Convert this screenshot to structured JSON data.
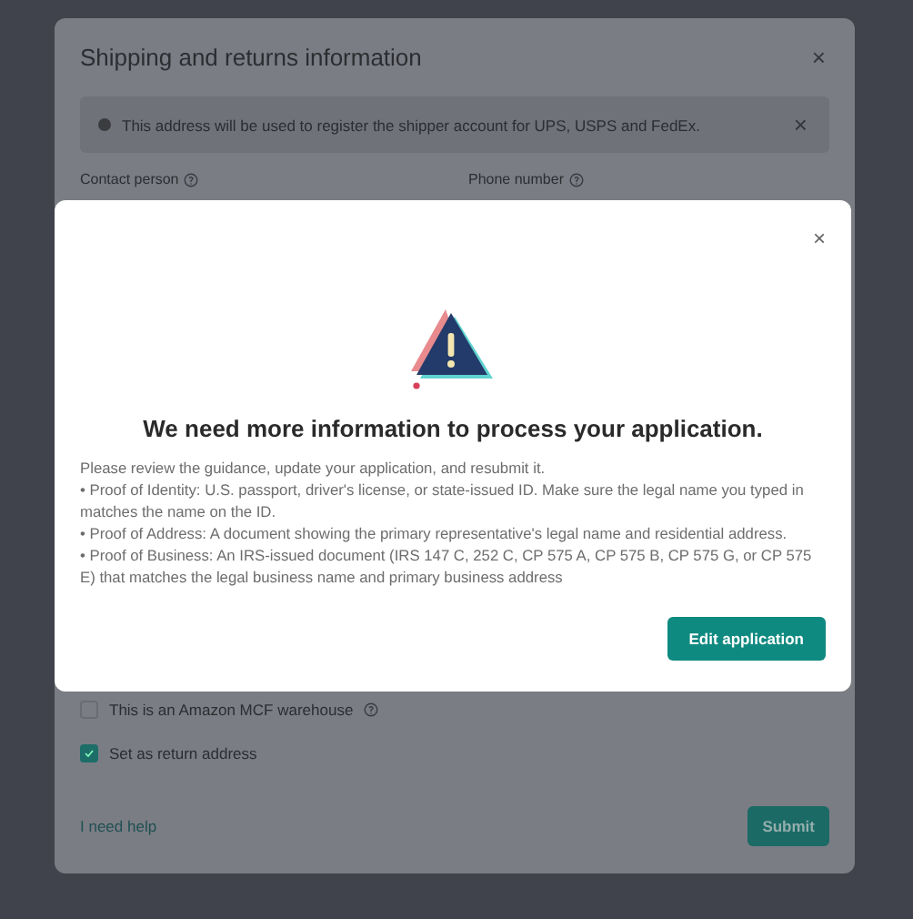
{
  "background_modal": {
    "title": "Shipping and returns information",
    "close": "×",
    "banner": {
      "text": "This address will be used to register the shipper account for UPS, USPS and FedEx.",
      "close": "×"
    },
    "fields": [
      {
        "label": "Contact person"
      },
      {
        "label": "Phone number"
      }
    ],
    "checkboxes": [
      {
        "label": "This is an Amazon MCF warehouse",
        "help": true,
        "checked": false
      },
      {
        "label": "Set as return address",
        "help": false,
        "checked": true
      }
    ],
    "help_link": "I need help",
    "submit": "Submit"
  },
  "dialog": {
    "close": "×",
    "title": "We need more information to process your application.",
    "lines": [
      "Please review the guidance, update your application, and resubmit it.",
      "• Proof of Identity: U.S. passport, driver's license, or state-issued ID. Make sure the legal name you typed in matches the name on the ID.",
      "• Proof of Address: A document showing the primary representative's legal name and residential address.",
      "• Proof of Business: An IRS-issued document (IRS 147 C, 252 C, CP 575 A, CP 575 B, CP 575 G, or CP 575 E) that matches the legal business name and primary business address"
    ],
    "button": "Edit application"
  }
}
